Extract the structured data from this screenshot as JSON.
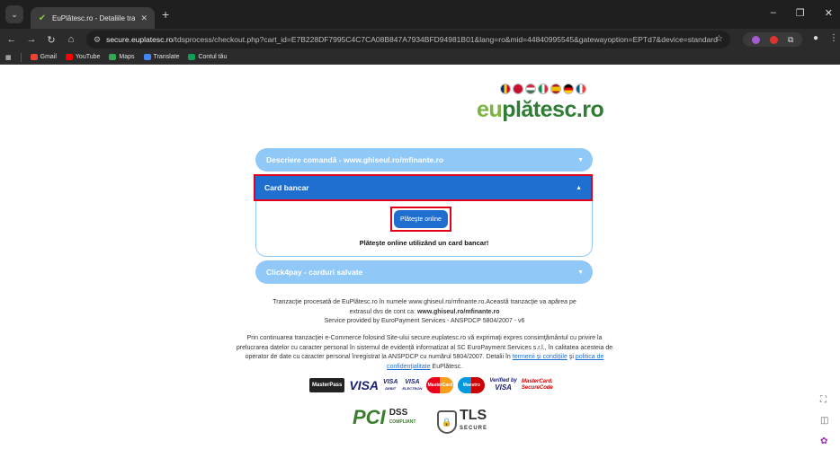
{
  "browser": {
    "tab_title": "EuPlătesc.ro - Detaliile tranzacț",
    "tab_close": "✕",
    "new_tab": "+",
    "url_host": "secure.euplatesc.ro",
    "url_path": "/tdsprocess/checkout.php?cart_id=E7B228DF7995C4C7CA08B847A7934BFD94981B01&lang=ro&mid=44840995545&gatewayoption=EPTd7&device=standard",
    "bookmarks": [
      {
        "label": "Gmail",
        "color": "#ea4335"
      },
      {
        "label": "YouTube",
        "color": "#ff0000"
      },
      {
        "label": "Maps",
        "color": "#34a853"
      },
      {
        "label": "Translate",
        "color": "#4285f4"
      },
      {
        "label": "Contul tău",
        "color": "#0f9d58"
      }
    ]
  },
  "page": {
    "logo_eu": "eu",
    "logo_rest": "plătesc.ro",
    "flag_colors": [
      "#ffcc00",
      "#c8102e",
      "#cc0000",
      "#009246",
      "#f1bf00",
      "#000000",
      "#0055a4"
    ],
    "sections": {
      "description": "Descriere comandă - www.ghiseul.ro/mfinante.ro",
      "card": "Card bancar",
      "click4pay": "Click4pay - carduri salvate"
    },
    "pay_button": "Plăteşte online",
    "pay_note": "Plăteşte online utilizând un card bancar!",
    "info1_line1": "Tranzacţie procesată de EuPlătesc.ro în numele www.ghiseul.ro/mfinante.ro.Această tranzacţie va apărea pe",
    "info1_line2a": "extrasul dvs de cont ca: ",
    "info1_line2b": "www.ghiseul.ro/mfinante.ro",
    "info1_line3": "Service provided by EuroPayment Services - ANSPDCP 5804/2007 - v6",
    "info2_text": "Prin continuarea tranzacţiei e-Commerce folosind Site-ului secure.euplatesc.ro vă exprimaţi expres consimţământul cu privire la prelucrarea datelor cu caracter personal în sistemul de evidenţă informatizat al SC EuroPayment Services s.r.l., în calitatea acesteia de operator de date cu caracter personal înregistrat la ANSPDCP cu numărul 5804/2007. Detalii în ",
    "info2_link1": "termenii şi condiţiile",
    "info2_mid": " şi ",
    "info2_link2": "politica de confidenţialitate",
    "info2_end": " EuPlătesc.",
    "logos": {
      "masterpass": "MasterPass",
      "visa": "VISA",
      "visa_debit_1": "VISA",
      "visa_debit_2": "DEBIT",
      "visa_electron_1": "VISA",
      "visa_electron_2": "ELECTRON",
      "mastercard": "MasterCard",
      "maestro": "Maestro",
      "vbv_1": "Verified by",
      "vbv_2": "VISA",
      "mcsc_1": "MasterCard.",
      "mcsc_2": "SecureCode",
      "pci": "PCI",
      "dss": "DSS",
      "dss_sub": "COMPLIANT",
      "tls": "TLS",
      "tls_sub": "SECURE"
    }
  }
}
